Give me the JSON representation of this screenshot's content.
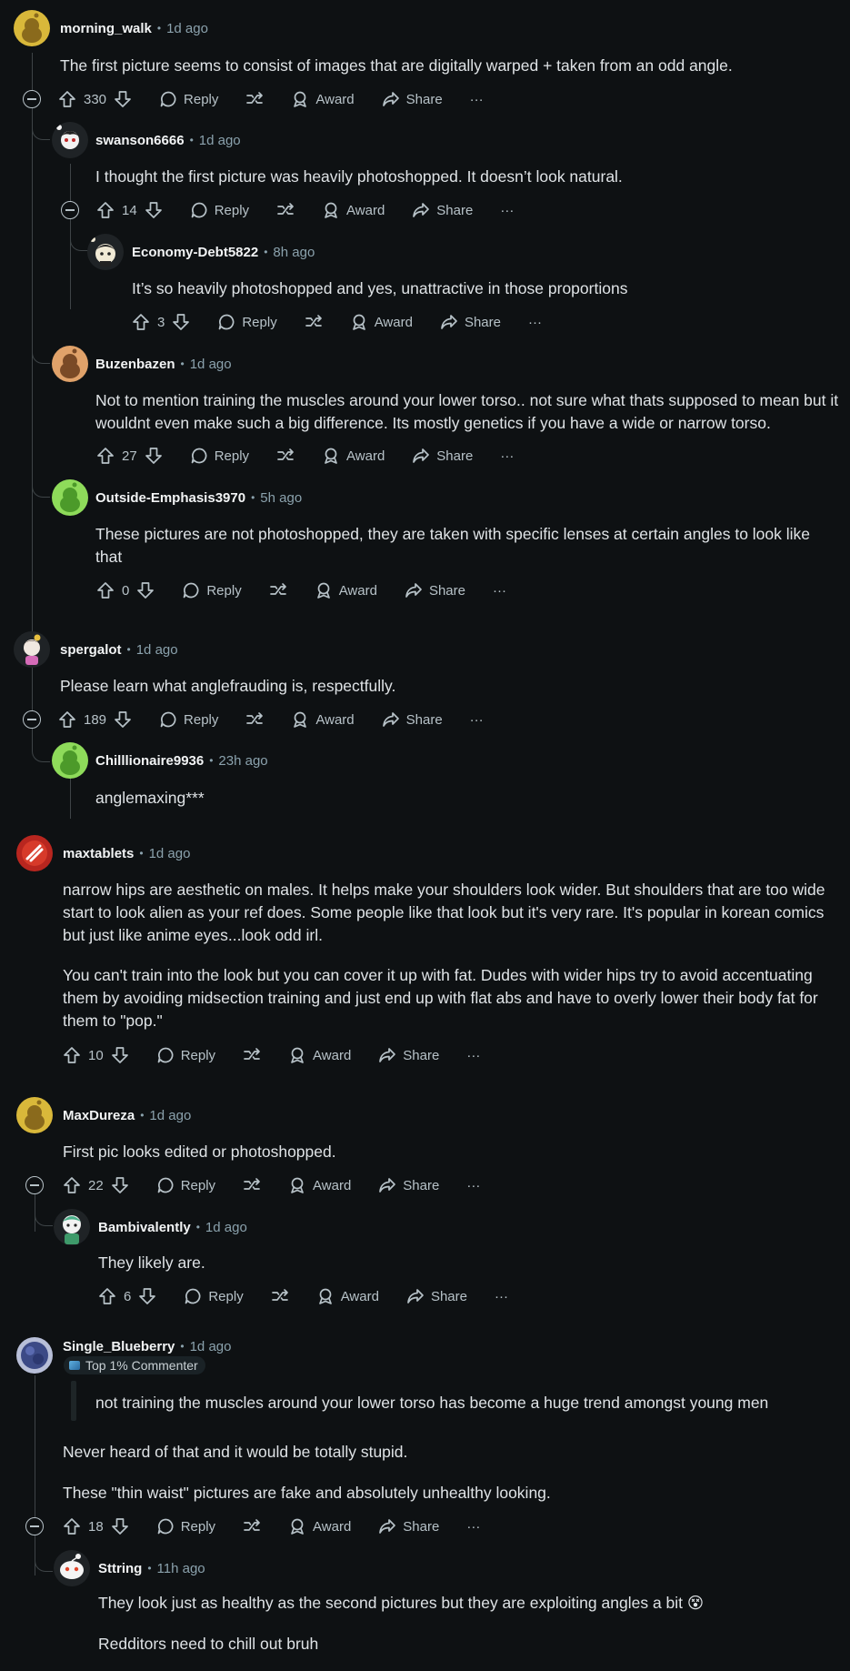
{
  "labels": {
    "reply": "Reply",
    "award": "Award",
    "share": "Share",
    "more": "···"
  },
  "comments": [
    {
      "user": "morning_walk",
      "age": "1d ago",
      "text": [
        "The first picture seems to consist of images that are digitally warped + taken from an odd angle."
      ],
      "votes": "330"
    },
    {
      "user": "swanson6666",
      "age": "1d ago",
      "text": [
        "I thought the first picture was heavily photoshopped. It doesn’t look natural."
      ],
      "votes": "14"
    },
    {
      "user": "Economy-Debt5822",
      "age": "8h ago",
      "text": [
        "It’s so heavily photoshopped and yes, unattractive in those proportions"
      ],
      "votes": "3"
    },
    {
      "user": "Buzenbazen",
      "age": "1d ago",
      "text": [
        "Not to mention training the muscles around your lower torso.. not sure what thats supposed to mean but it wouldnt even make such a big difference. Its mostly genetics if you have a wide or narrow torso."
      ],
      "votes": "27"
    },
    {
      "user": "Outside-Emphasis3970",
      "age": "5h ago",
      "text": [
        "These pictures are not photoshopped, they are taken with specific lenses at certain angles to look like that"
      ],
      "votes": "0"
    },
    {
      "user": "spergalot",
      "age": "1d ago",
      "text": [
        "Please learn what anglefrauding is, respectfully."
      ],
      "votes": "189"
    },
    {
      "user": "Chilllionaire9936",
      "age": "23h ago",
      "text": [
        "anglemaxing***"
      ]
    },
    {
      "user": "maxtablets",
      "age": "1d ago",
      "text": [
        "narrow hips are aesthetic on males. It helps make your shoulders look wider. But shoulders that are too wide start to look alien as your ref does. Some people like that look but it's very rare. It's popular in korean comics but just like anime eyes...look odd irl.",
        "You can't train into the look but you can cover it up with fat. Dudes with wider hips try to avoid accentuating them by avoiding midsection training and just end up with flat abs and have to overly lower their body fat for them to \"pop.\""
      ],
      "votes": "10"
    },
    {
      "user": "MaxDureza",
      "age": "1d ago",
      "text": [
        "First pic looks edited or photoshopped."
      ],
      "votes": "22"
    },
    {
      "user": "Bambivalently",
      "age": "1d ago",
      "text": [
        "They likely are."
      ],
      "votes": "6"
    },
    {
      "user": "Single_Blueberry",
      "age": "1d ago",
      "flair": "Top 1% Commenter",
      "quote": "not training the muscles around your lower torso has become a huge trend amongst young men",
      "text": [
        "Never heard of that and it would be totally stupid.",
        "These \"thin waist\" pictures are fake and absolutely unhealthy looking."
      ],
      "votes": "18"
    },
    {
      "user": "Sttring",
      "age": "11h ago",
      "text": [
        "They look just as healthy as the second pictures but they are exploiting angles a bit 😵",
        "Redditors need to chill out bruh"
      ]
    }
  ],
  "colors": {
    "background": "#0e1113",
    "thread_line": "#3e4447",
    "meta": "#8ba2ad",
    "username": "#f2f4f5"
  },
  "icons": [
    "upvote-icon",
    "downvote-icon",
    "reply-icon",
    "crosspost-icon",
    "award-icon",
    "share-icon",
    "collapse-icon"
  ]
}
